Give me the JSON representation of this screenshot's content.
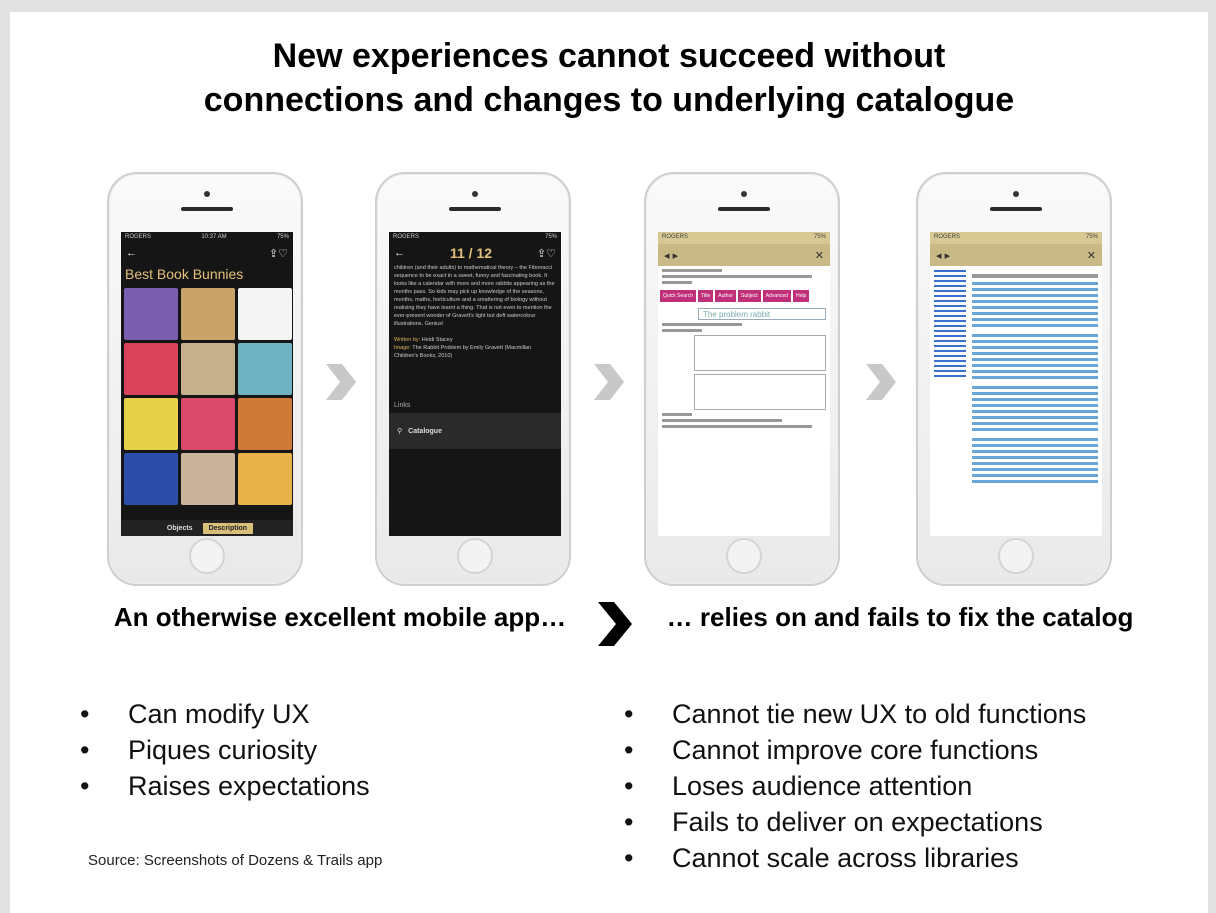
{
  "slide": {
    "title_line1": "New experiences cannot succeed without",
    "title_line2": "connections and changes to underlying catalogue"
  },
  "phones": {
    "phone1": {
      "status": "ROGERS",
      "time": "10:37 AM",
      "battery": "75%",
      "back_glyph": "←",
      "share_glyph": "⇪♡",
      "heading": "Best Book Bunnies",
      "tiles": [
        "#7a5fb0",
        "#c9a46a",
        "#f4f4f4",
        "#d8425b",
        "#c6b08b",
        "#6fb3c2",
        "#e6d24a",
        "#d94a6a",
        "#d07a3a",
        "#2c4da8",
        "#c9b39a",
        "#e8b24a"
      ],
      "tab_objects": "Objects",
      "tab_description": "Description"
    },
    "phone2": {
      "counter": "11 / 12",
      "body": "children (and their adults) to mathematical theory – the Fibonacci sequence to be exact in a sweet, funny and fascinating book. It looks like a calendar with more and more rabbits appearing as the months pass. So kids may pick up knowledge of the seasons, months, maths, horticulture and a smattering of biology without realising they have learnt a thing. That is not even to mention the ever-present wonder of Gravett's light but deft watercolour illustrations. Genius!",
      "written_by_label": "Written by:",
      "written_by": "Heidi Stacey",
      "image_label": "Image:",
      "image": "The Rabbit Problem by Emily Gravett (Macmillan Children's Books, 2010)",
      "links_label": "Links",
      "catalogue_label": "Catalogue"
    },
    "phone3": {
      "search_value": "The problem rabbit",
      "tabs": [
        "Quick Search",
        "Title",
        "Author",
        "Subject",
        "Advanced",
        "Help"
      ],
      "close_glyph": "✕"
    },
    "phone4": {
      "close_glyph": "✕"
    }
  },
  "left": {
    "heading": "An otherwise excellent mobile app…",
    "bullets": [
      "Can modify UX",
      "Piques curiosity",
      "Raises expectations"
    ],
    "source": "Source: Screenshots of Dozens & Trails app"
  },
  "right": {
    "heading": "… relies on and fails to fix the catalog",
    "bullets": [
      "Cannot tie new UX to old functions",
      "Cannot improve core functions",
      "Loses audience attention",
      "Fails to deliver on expectations",
      "Cannot scale across libraries"
    ]
  },
  "colors": {
    "gold": "#e4c07a",
    "chevron_grey": "#c8c8c8",
    "chevron_black": "#000000",
    "catalog_pink": "#c0307a"
  }
}
